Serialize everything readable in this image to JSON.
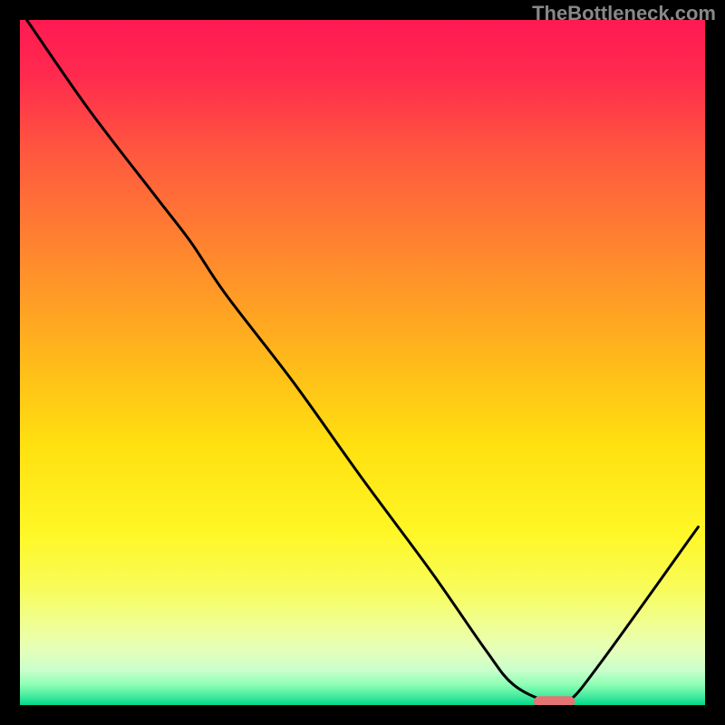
{
  "watermark": "TheBottleneck.com",
  "chart_data": {
    "type": "area",
    "title": "",
    "xlabel": "",
    "ylabel": "",
    "xlim": [
      0,
      100
    ],
    "ylim": [
      0,
      100
    ],
    "axes_visible": false,
    "legend": false,
    "grid": false,
    "background_gradient": {
      "stops": [
        {
          "pos": 0.0,
          "color": "#ff1a52"
        },
        {
          "pos": 0.08,
          "color": "#ff2a4e"
        },
        {
          "pos": 0.2,
          "color": "#ff5a3e"
        },
        {
          "pos": 0.35,
          "color": "#ff8a2d"
        },
        {
          "pos": 0.5,
          "color": "#ffba1a"
        },
        {
          "pos": 0.62,
          "color": "#ffe010"
        },
        {
          "pos": 0.75,
          "color": "#fff726"
        },
        {
          "pos": 0.83,
          "color": "#f8fc5a"
        },
        {
          "pos": 0.88,
          "color": "#f0ff90"
        },
        {
          "pos": 0.92,
          "color": "#e5ffba"
        },
        {
          "pos": 0.95,
          "color": "#c8ffcc"
        },
        {
          "pos": 0.97,
          "color": "#8effb4"
        },
        {
          "pos": 0.985,
          "color": "#4eeea0"
        },
        {
          "pos": 1.0,
          "color": "#00d98c"
        }
      ]
    },
    "curve": {
      "description": "Bottleneck / mismatch curve; minimum indicates optimal match.",
      "note": "x and y are in plot-percent coordinates (0..100). y=100 is top.",
      "x": [
        1,
        10,
        20,
        25,
        30,
        40,
        50,
        60,
        68,
        72,
        77,
        80,
        85,
        99
      ],
      "y": [
        100,
        87,
        74,
        67.5,
        60,
        47,
        33,
        19.5,
        8,
        3,
        0.5,
        0.5,
        6.5,
        26
      ]
    },
    "minimum_marker": {
      "x_center": 78,
      "x_width": 6,
      "y": 0.5,
      "color": "#e57373"
    }
  }
}
